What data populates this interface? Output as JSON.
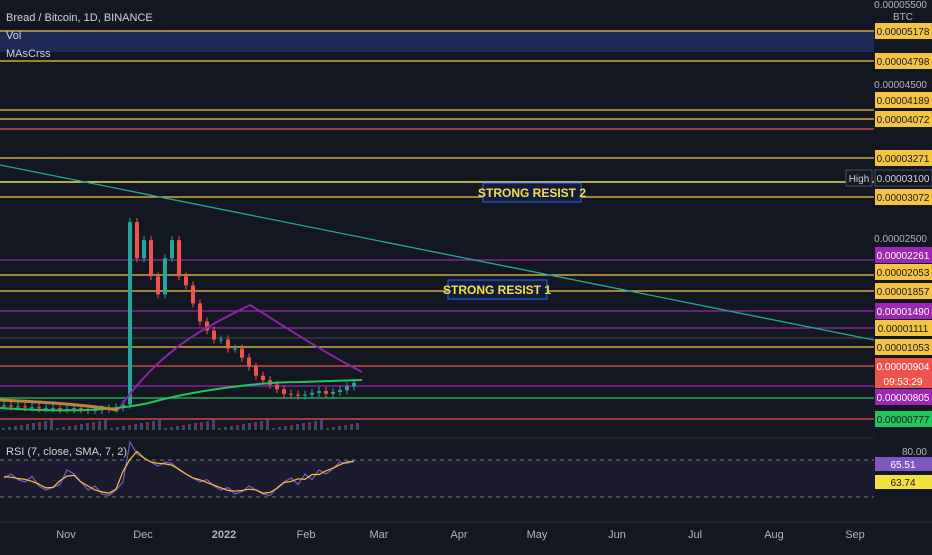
{
  "header": {
    "symbol_line": "Bread / Bitcoin, 1D, BINANCE",
    "vol_label": "Vol",
    "ma_label": "MAsCrss",
    "currency": "BTC"
  },
  "rsi": {
    "label": "RSI (7, close, SMA, 7, 2)",
    "tick_80": "80.00",
    "value": "65.51",
    "sma_value": "63.74",
    "upper_band": 80,
    "lower_band": 20
  },
  "chart_data": {
    "type": "candlestick",
    "title": "Bread / Bitcoin, 1D, BINANCE",
    "x_ticks": [
      "Nov",
      "Dec",
      "2022",
      "Feb",
      "Mar",
      "Apr",
      "May",
      "Jun",
      "Jul",
      "Aug",
      "Sep"
    ],
    "y_ticks": [
      "0.00005500",
      "0.00004500",
      "0.00002500"
    ],
    "price_levels": [
      {
        "label": "0.00005178",
        "color": "#f5c542"
      },
      {
        "label": "0.00004798",
        "color": "#f5c542"
      },
      {
        "label": "0.00004189",
        "color": "#f5c542"
      },
      {
        "label": "0.00004072",
        "color": "#f5c542"
      },
      {
        "label": "0.00003271",
        "color": "#f5c542"
      },
      {
        "label": "0.00003072",
        "color": "#f5c542"
      },
      {
        "label": "0.00002261",
        "color": "#9c27b0"
      },
      {
        "label": "0.00002053",
        "color": "#f5c542"
      },
      {
        "label": "0.00001857",
        "color": "#f5c542"
      },
      {
        "label": "0.00001490",
        "color": "#9c27b0"
      },
      {
        "label": "0.00001111",
        "color": "#f5c542"
      },
      {
        "label": "0.00001053",
        "color": "#f5c542"
      },
      {
        "label": "0.00000904",
        "color": "#ef5350"
      },
      {
        "label": "0.00000805",
        "color": "#9c27b0"
      },
      {
        "label": "0.00000777",
        "color": "#22c55e"
      }
    ],
    "high_tag": {
      "label": "High",
      "value": "0.00003100"
    },
    "countdown": "09:53:29",
    "annotations": [
      "STRONG RESIST 2",
      "STRONG RESIST 1"
    ],
    "series": [
      {
        "name": "close",
        "values": [
          6.7e-06,
          6.6e-06,
          6.6e-06,
          6.5e-06,
          6.5e-06,
          6.4e-06,
          6.4e-06,
          6.4e-06,
          6.3e-06,
          6.3e-06,
          6.4e-06,
          6.3e-06,
          6.2e-06,
          6.2e-06,
          6.3e-06,
          6.4e-06,
          6.5e-06,
          6.8e-06,
          2.7e-05,
          2.3e-05,
          2.5e-05,
          2.1e-05,
          1.9e-05,
          2.3e-05,
          2.5e-05,
          2.1e-05,
          2e-05,
          1.8e-05,
          1.6e-05,
          1.5e-05,
          1.4e-05,
          1.4e-05,
          1.3e-05,
          1.3e-05,
          1.2e-05,
          1.1e-05,
          1e-05,
          9.5e-06,
          9e-06,
          8.5e-06,
          8e-06,
          7.9e-06,
          7.8e-06,
          7.9e-06,
          8.1e-06,
          8.3e-06,
          8e-06,
          8.2e-06,
          8.4e-06,
          8.8e-06,
          9.2e-06
        ]
      }
    ],
    "rsi_values": [
      50,
      55,
      48,
      45,
      52,
      40,
      35,
      38,
      42,
      60,
      55,
      45,
      35,
      40,
      30,
      28,
      35,
      45,
      95,
      80,
      75,
      70,
      65,
      70,
      68,
      60,
      55,
      50,
      45,
      48,
      40,
      35,
      38,
      30,
      33,
      40,
      35,
      30,
      28,
      38,
      45,
      50,
      42,
      55,
      48,
      60,
      55,
      62,
      70,
      68,
      72
    ]
  }
}
